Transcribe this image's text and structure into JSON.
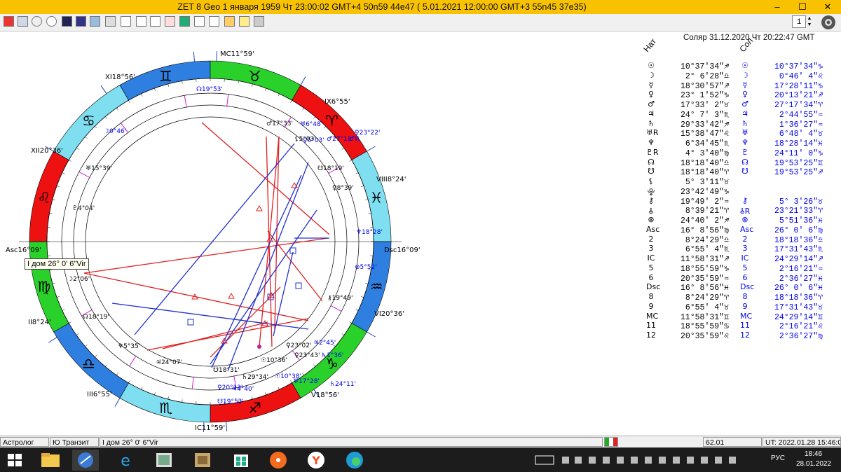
{
  "window": {
    "title": "ZET 8 Geo    1 января 1959  Чт  23:00:02 GMT+4 50n59  44e47  ( 5.01.2021  12:00:00 GMT+3 55n45 37e35)",
    "min": "–",
    "max": "☐",
    "close": "✕"
  },
  "toolbar": {
    "spin_value": "1"
  },
  "solar_header": "Соляр 31.12.2020  Чт 20:22:47 GMT",
  "columns": {
    "natal": "Нат",
    "solar": "Сол"
  },
  "planets": [
    {
      "g1": "☉",
      "v1": "10°37'34\"♐",
      "g2": "☉",
      "v2": "10°37'34\"♑"
    },
    {
      "g1": "☽",
      "v1": "2° 6'28\"♎",
      "g2": "☽",
      "v2": "0°46' 4\"♌"
    },
    {
      "g1": "☿",
      "v1": "18°30'57\"♐",
      "g2": "☿",
      "v2": "17°28'11\"♑"
    },
    {
      "g1": "♀",
      "v1": "23° 1'52\"♑",
      "g2": "♀",
      "v2": "20°13'21\"♐"
    },
    {
      "g1": "♂",
      "v1": "17°33' 2\"♉",
      "g2": "♂",
      "v2": "27°17'34\"♈"
    },
    {
      "g1": "♃",
      "v1": "24° 7' 3\"♏",
      "g2": "♃",
      "v2": "2°44'55\"♒"
    },
    {
      "g1": "♄",
      "v1": "29°33'42\"♐",
      "g2": "♄",
      "v2": "1°36'27\"♒"
    },
    {
      "g1": "♅R",
      "v1": "15°38'47\"♌",
      "g2": "♅",
      "v2": "6°48' 4\"♉"
    },
    {
      "g1": "♆",
      "v1": "6°34'45\"♏",
      "g2": "♆",
      "v2": "18°28'14\"♓"
    },
    {
      "g1": "♇R",
      "v1": "4° 3'40\"♍",
      "g2": "♇",
      "v2": "24°11' 0\"♑"
    },
    {
      "g1": "☊",
      "v1": "18°18'40\"♎",
      "g2": "☊",
      "v2": "19°53'25\"♊"
    },
    {
      "g1": "☋",
      "v1": "18°18'40\"♈",
      "g2": "☋",
      "v2": "19°53'25\"♐"
    },
    {
      "g1": "⚸",
      "v1": "5° 3'11\"♉",
      "g2": "",
      "v2": ""
    },
    {
      "g1": "⯓",
      "v1": "23°42'49\"♑",
      "g2": "",
      "v2": ""
    },
    {
      "g1": "⚷",
      "v1": "19°49' 2\"♒",
      "g2": "⚷",
      "v2": "5° 3'26\"♉"
    },
    {
      "g1": "⯗",
      "v1": "8°39'21\"♈",
      "g2": "⯗R",
      "v2": "23°21'33\"♈"
    },
    {
      "g1": "⊗",
      "v1": "24°40' 2\"♐",
      "g2": "⊗",
      "v2": "5°51'36\"♓"
    },
    {
      "g1": "Asc",
      "v1": "16° 8'56\"♍",
      "g2": "Asc",
      "v2": "26° 0' 6\"♍"
    },
    {
      "g1": "2",
      "v1": "8°24'29\"♎",
      "g2": "2",
      "v2": "18°18'36\"♎"
    },
    {
      "g1": "3",
      "v1": "6°55' 4\"♏",
      "g2": "3",
      "v2": "17°31'43\"♏"
    },
    {
      "g1": "IC",
      "v1": "11°58'31\"♐",
      "g2": "IC",
      "v2": "24°29'14\"♐"
    },
    {
      "g1": "5",
      "v1": "18°55'59\"♑",
      "g2": "5",
      "v2": "2°16'21\"♒"
    },
    {
      "g1": "6",
      "v1": "20°35'59\"♒",
      "g2": "6",
      "v2": "2°36'27\"♓"
    },
    {
      "g1": "Dsc",
      "v1": "16° 8'56\"♓",
      "g2": "Dsc",
      "v2": "26° 0' 6\"♓"
    },
    {
      "g1": "8",
      "v1": "8°24'29\"♈",
      "g2": "8",
      "v2": "18°18'36\"♈"
    },
    {
      "g1": "9",
      "v1": "6°55' 4\"♉",
      "g2": "9",
      "v2": "17°31'43\"♉"
    },
    {
      "g1": "MC",
      "v1": "11°58'31\"♊",
      "g2": "MC",
      "v2": "24°29'14\"♊"
    },
    {
      "g1": "11",
      "v1": "18°55'59\"♋",
      "g2": "11",
      "v2": "2°16'21\"♌"
    },
    {
      "g1": "12",
      "v1": "20°35'59\"♌",
      "g2": "12",
      "v2": "2°36'27\"♍"
    }
  ],
  "wheel": {
    "angles": {
      "mc": "MC11°59'",
      "ic": "IC11°59'",
      "asc": "Asc16°09'",
      "dsc": "Dsc16°09'"
    },
    "houses": [
      {
        "id": "h11",
        "label": "XI18°56'"
      },
      {
        "id": "h12",
        "label": "XII20°36'"
      },
      {
        "id": "h2",
        "label": "II8°24'"
      },
      {
        "id": "h3",
        "label": "III6°55'"
      },
      {
        "id": "h5",
        "label": "V18°56'"
      },
      {
        "id": "h6",
        "label": "VI20°36'"
      },
      {
        "id": "h8",
        "label": "VIII8°24'"
      },
      {
        "id": "h9",
        "label": "IX6°55'"
      }
    ],
    "signs": [
      "♊",
      "♉",
      "♈",
      "♓",
      "♒",
      "♑",
      "♐",
      "♏",
      "♎",
      "♍",
      "♌",
      "♋"
    ],
    "outer_labels": [
      "☊19°53'",
      "♅6°48'",
      "♂27°18'",
      "♀23°22'",
      "♂ℝ",
      "♀5°03'",
      "♆18°28'",
      "⊗5°52'",
      "♃2°45'",
      "♄1°36'",
      "☉10°38'",
      "♅17°28'",
      "♄24°11'",
      "☋19°53'",
      "♀20°13'",
      "♃4°40'",
      "☽0°46'"
    ],
    "inner_labels": [
      "♂17°33'",
      "⚸5°03'",
      "☋18°19'",
      "♀8°39'",
      "♅15°39'",
      "♇4°04'",
      "☽2°06'",
      "☊18°19'",
      "♆5°35'",
      "♃24°07'",
      "☋18°31'",
      "♄29°34'",
      "☉10°36'",
      "♀23°02'",
      "♀23°43'",
      "⚷19°49'"
    ]
  },
  "tooltip": "I дом 26° 0' 6\"Vir",
  "status": {
    "p1": "Астролог",
    "p2": "Ю Транзит",
    "p3": "I дом 26° 0' 6\"Vir",
    "p4": "62.01",
    "p5": "UT: 2022.01.28 15:46:09"
  },
  "taskbar": {
    "lang": "РУС",
    "time": "18:46",
    "date": "28.01.2022"
  }
}
